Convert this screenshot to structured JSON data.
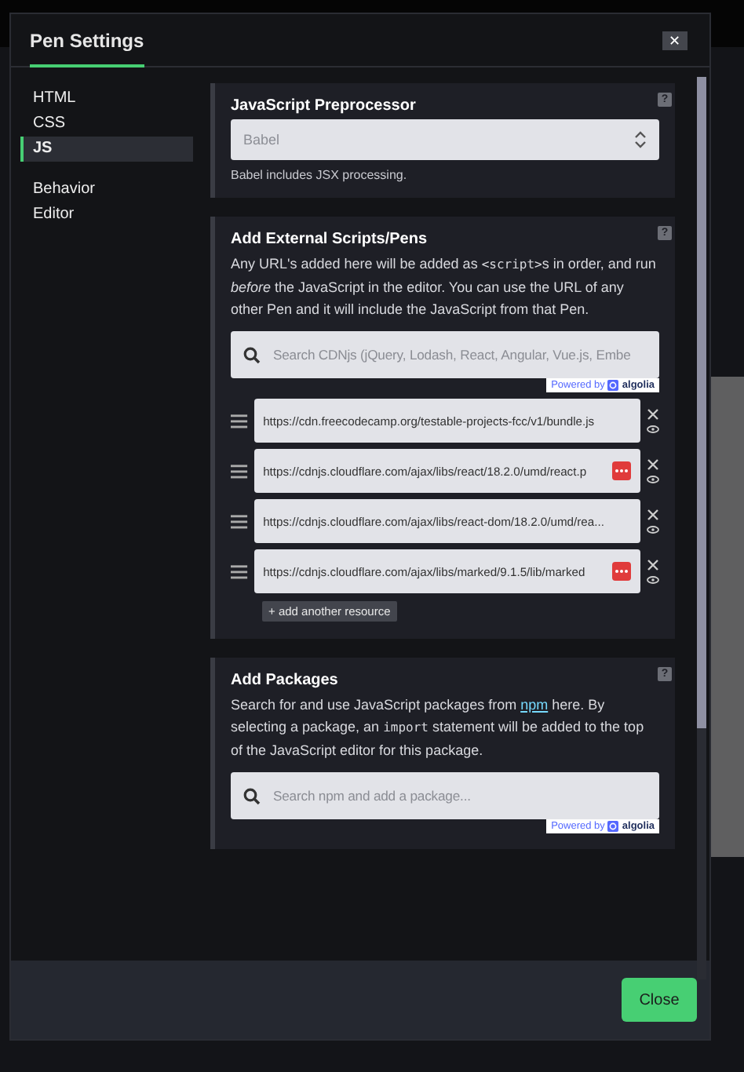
{
  "dialog": {
    "title": "Pen Settings",
    "close_label": "✕"
  },
  "sidebar": {
    "groups": [
      [
        {
          "label": "HTML",
          "selected": false
        },
        {
          "label": "CSS",
          "selected": false
        },
        {
          "label": "JS",
          "selected": true
        }
      ],
      [
        {
          "label": "Behavior",
          "selected": false
        },
        {
          "label": "Editor",
          "selected": false
        }
      ]
    ]
  },
  "sections": [
    {
      "kind": "preprocessor",
      "title": "JavaScript Preprocessor",
      "help": "?",
      "select": {
        "value": "Babel"
      },
      "note": "Babel includes JSX processing."
    },
    {
      "kind": "scripts",
      "title": "Add External Scripts/Pens",
      "help": "?",
      "description": [
        {
          "kind": "text",
          "text": "Any URL's added here will be added as "
        },
        {
          "kind": "code",
          "text": "<script>"
        },
        {
          "kind": "text",
          "text": "s in order, and run "
        },
        {
          "kind": "italic",
          "text": "before"
        },
        {
          "kind": "text",
          "text": " the JavaScript in the editor. You can use the URL of any other Pen and it will include the JavaScript from that Pen."
        }
      ],
      "search": {
        "placeholder": "Search CDNjs (jQuery, Lodash, React, Angular, Vue.js, Embe",
        "powered_by": "Powered by",
        "brand": "algolia"
      },
      "resources": [
        {
          "url": "https://cdn.freecodecamp.org/testable-projects-fcc/v1/bundle.js",
          "flagged": false
        },
        {
          "url": "https://cdnjs.cloudflare.com/ajax/libs/react/18.2.0/umd/react.p",
          "flagged": true
        },
        {
          "url": "https://cdnjs.cloudflare.com/ajax/libs/react-dom/18.2.0/umd/rea...",
          "flagged": false
        },
        {
          "url": "https://cdnjs.cloudflare.com/ajax/libs/marked/9.1.5/lib/marked",
          "flagged": true
        }
      ],
      "add_button": "+ add another resource"
    },
    {
      "kind": "packages",
      "title": "Add Packages",
      "help": "?",
      "description": [
        {
          "kind": "text",
          "text": "Search for and use JavaScript packages from "
        },
        {
          "kind": "link",
          "text": "npm"
        },
        {
          "kind": "text",
          "text": " here. By selecting a package, an "
        },
        {
          "kind": "code",
          "text": "import"
        },
        {
          "kind": "text",
          "text": " statement will be added to the top of the JavaScript editor for this package."
        }
      ],
      "search": {
        "placeholder": "Search npm and add a package...",
        "powered_by": "Powered by",
        "brand": "algolia"
      }
    }
  ],
  "footer": {
    "close_button": "Close"
  }
}
